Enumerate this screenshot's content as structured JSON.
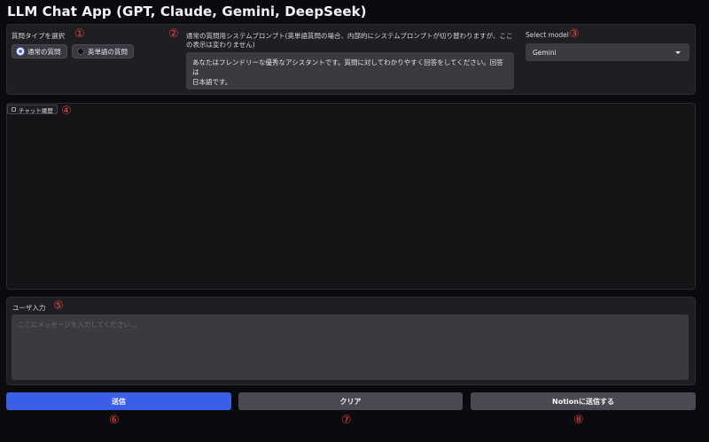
{
  "app": {
    "title": "LLM Chat App (GPT, Claude, Gemini, DeepSeek)"
  },
  "markers": [
    "①",
    "②",
    "③",
    "④",
    "⑤",
    "⑥",
    "⑦",
    "⑧"
  ],
  "question_type": {
    "label": "質問タイプを選択",
    "options": [
      "通常の質問",
      "英単語の質問"
    ],
    "selected": "通常の質問"
  },
  "system_prompt": {
    "label_line1": "通常の質問用システムプロンプト(英単語質問の場合、内部的にシステムプロンプトが切り替わりますが、ここ",
    "label_line2": "の表示は変わりません)",
    "value_line1": "あなたはフレンドリーな優秀なアシスタントです。質問に対してわかりやすく回答をしてください。回答は",
    "value_line2": "日本語です。"
  },
  "model": {
    "label": "Select model",
    "selected": "Gemini"
  },
  "chat": {
    "label": "チャット履歴"
  },
  "user_input": {
    "label": "ユーザ入力",
    "placeholder": "ここにメッセージを入力してください..."
  },
  "buttons": {
    "send": "送信",
    "clear": "クリア",
    "notion": "Notionに送信する"
  },
  "colors": {
    "accent": "#3b5ee8",
    "marker": "#e0443a",
    "panel": "#1f1f23",
    "background": "#0b0b0f"
  }
}
